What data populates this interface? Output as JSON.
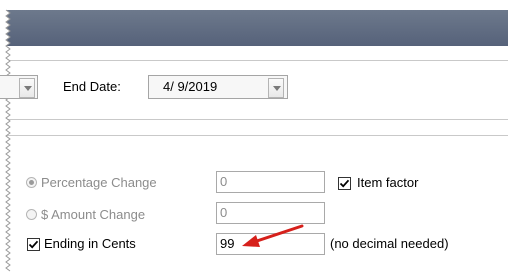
{
  "dates": {
    "end_date_label": "End Date:",
    "end_date_value": "4/  9/2019"
  },
  "pricing": {
    "percentage_change_label": "Percentage Change",
    "percentage_change_value": "0",
    "percentage_change_selected": true,
    "amount_change_label": "$ Amount Change",
    "amount_change_value": "0",
    "amount_change_selected": false,
    "item_factor_label": "Item factor",
    "item_factor_checked": true,
    "ending_in_cents_label": "Ending in Cents",
    "ending_in_cents_checked": true,
    "ending_in_cents_value": "99",
    "ending_in_cents_hint": "(no decimal needed)"
  },
  "colors": {
    "title_bar": "#5f6b7e",
    "annotation_arrow": "#d6201b"
  }
}
